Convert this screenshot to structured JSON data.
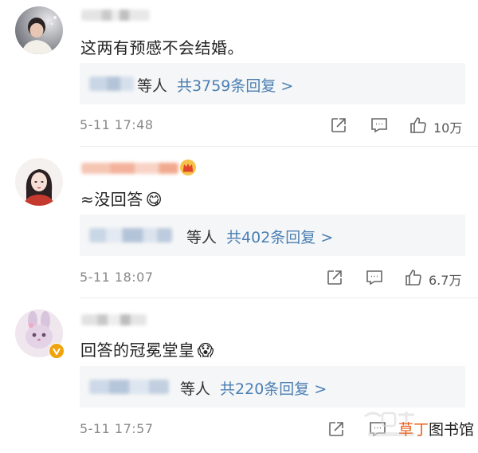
{
  "comments": [
    {
      "text": "这两有预感不会结婚。",
      "reply_who": "等人",
      "reply_count": "共3759条回复 >",
      "date": "5-11 17:48",
      "likes": "10万"
    },
    {
      "text": "≈没回答",
      "emoji": "😋",
      "reply_who": "等人",
      "reply_count": "共402条回复 >",
      "date": "5-11 18:07",
      "likes": "6.7万"
    },
    {
      "text": "回答的冠冕堂皇",
      "emoji": "😱",
      "reply_who": "等人",
      "reply_count": "共220条回复 >",
      "date": "5-11 17:57",
      "likes": ""
    }
  ],
  "watermark": {
    "brand_orange": "草丁",
    "brand_dark": "图书馆"
  },
  "colors": {
    "link_blue": "#4a7fb3",
    "reply_bg": "#f5f6f7",
    "meta_gray": "#888888",
    "verified_badge": "#f0a30a",
    "brand_orange": "#e8601c"
  },
  "icons": [
    "share-icon",
    "comment-icon",
    "like-icon",
    "verified-badge-icon",
    "crown-badge-icon"
  ]
}
